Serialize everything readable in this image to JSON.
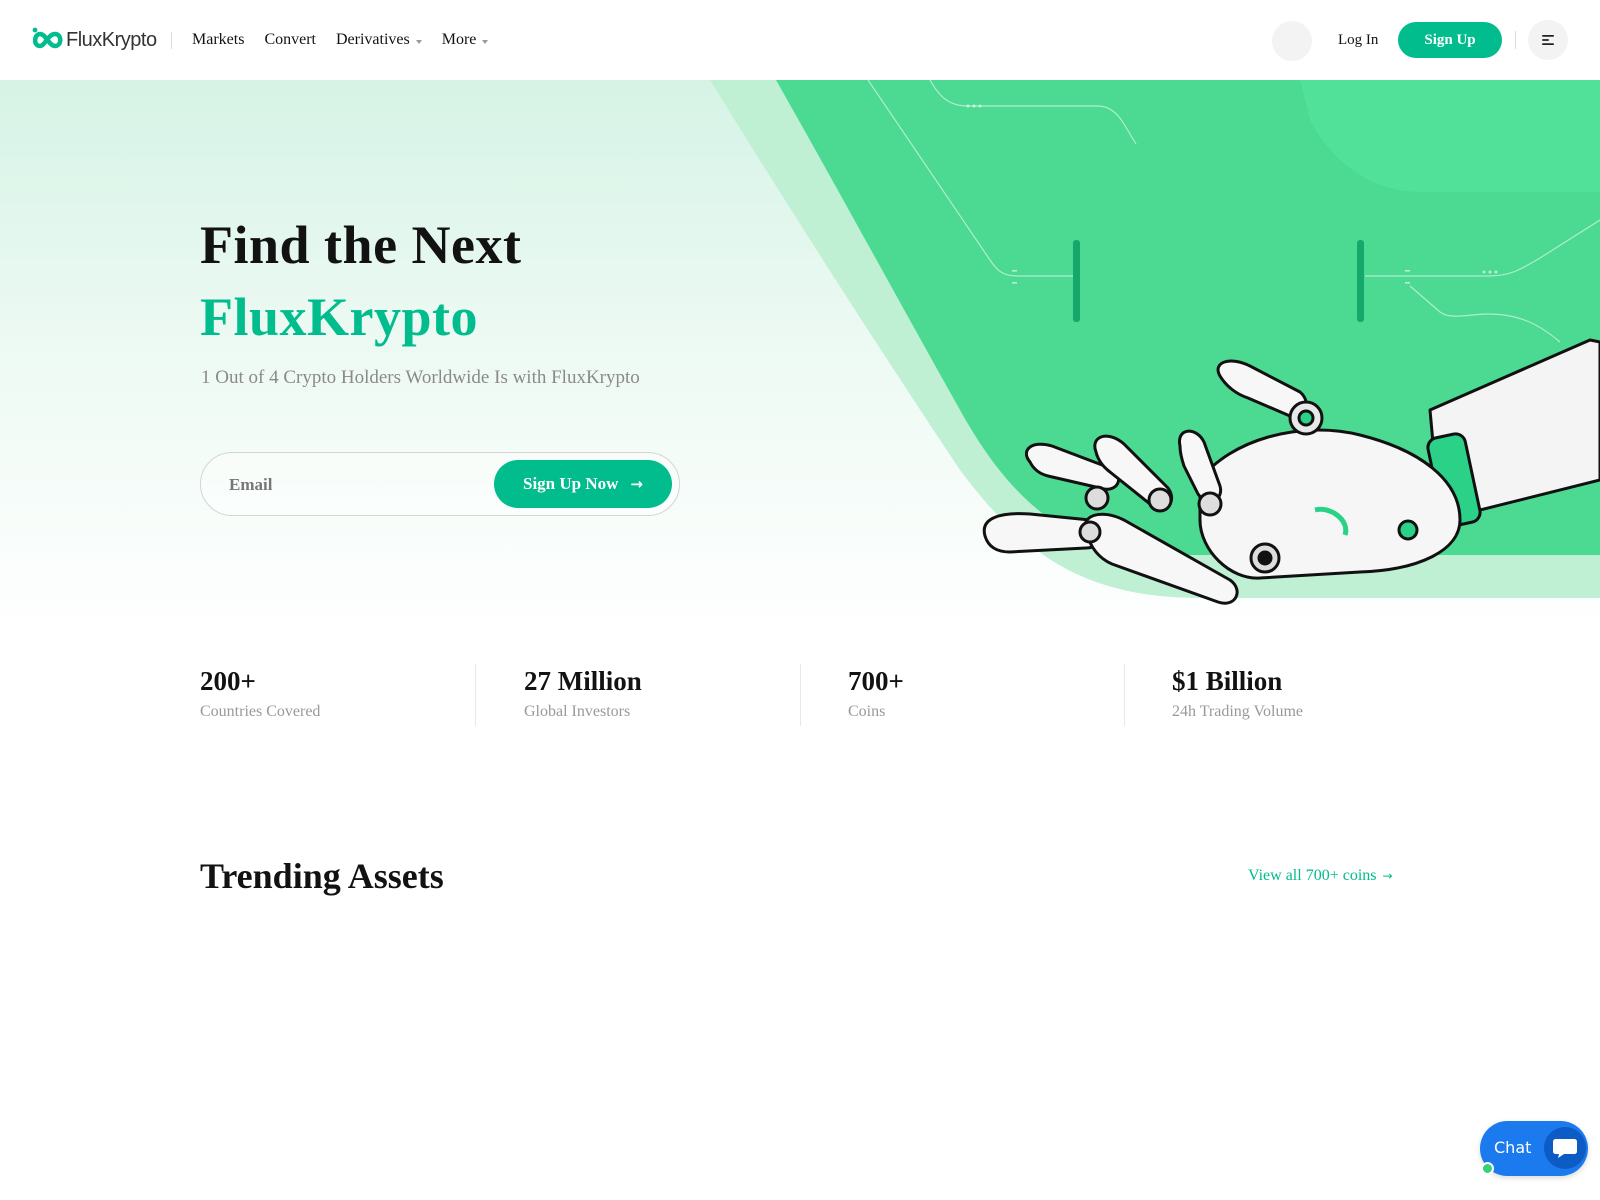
{
  "brand": {
    "name": "FluxKrypto",
    "accent_color": "#01bc8d",
    "hero_green": "#4cd992"
  },
  "nav": {
    "items": [
      {
        "label": "Markets",
        "has_dropdown": false
      },
      {
        "label": "Convert",
        "has_dropdown": false
      },
      {
        "label": "Derivatives",
        "has_dropdown": true
      },
      {
        "label": "More",
        "has_dropdown": true
      }
    ]
  },
  "header": {
    "login_label": "Log In",
    "signup_label": "Sign Up",
    "menu_icon": "hamburger-icon"
  },
  "hero": {
    "title_line1": "Find the Next",
    "title_line2": "FluxKrypto",
    "subtitle": "1 Out of 4 Crypto Holders Worldwide Is with FluxKrypto",
    "email_placeholder": "Email",
    "cta_label": "Sign Up Now",
    "cta_icon": "arrow-right-icon"
  },
  "stats": [
    {
      "value": "200+",
      "label": "Countries Covered"
    },
    {
      "value": "27 Million",
      "label": "Global Investors"
    },
    {
      "value": "700+",
      "label": "Coins"
    },
    {
      "value": "$1 Billion",
      "label": "24h Trading Volume"
    }
  ],
  "trending": {
    "title": "Trending Assets",
    "view_all_label": "View all 700+ coins",
    "view_all_icon": "arrow-right-icon"
  },
  "chat": {
    "label": "Chat",
    "icon": "chat-bubble-icon",
    "status_color": "#33d17a",
    "button_color": "#1a7aee"
  }
}
